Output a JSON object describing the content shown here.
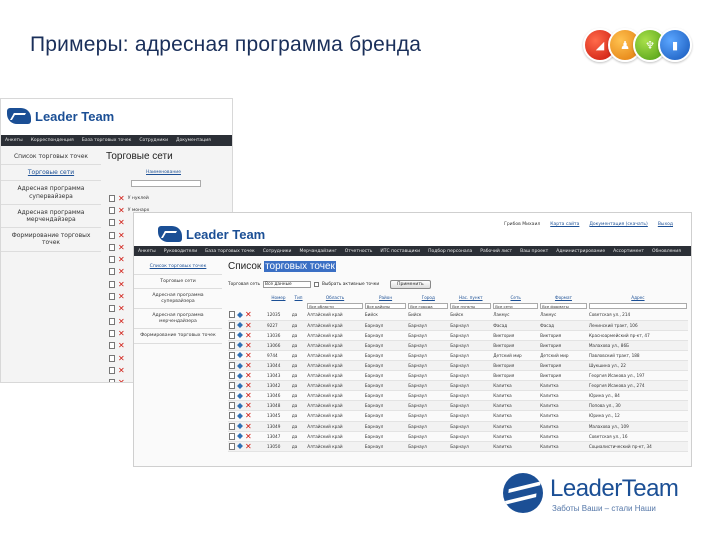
{
  "slide": {
    "title": "Примеры: адресная программа бренда"
  },
  "badges": [
    {
      "icon": "chart-bars-icon",
      "glyph": "◢",
      "color": "#d3160c"
    },
    {
      "icon": "people-icon",
      "glyph": "♟",
      "color": "#e8870f"
    },
    {
      "icon": "trophy-icon",
      "glyph": "♆",
      "color": "#5aa51a"
    },
    {
      "icon": "book-icon",
      "glyph": "▮",
      "color": "#1c5fc0"
    }
  ],
  "back_screen": {
    "logo": "Leader Team",
    "menu": [
      "Анкеты",
      "Корреспонденция",
      "База торговых точек",
      "Сотрудники",
      "Документация"
    ],
    "sidebar": [
      "Список торговых точек",
      "Торговые сети",
      "Адресная программа супервайзера",
      "Адресная программа мерчендайзера",
      "Формирование торговых точек"
    ],
    "title": "Торговые сети",
    "link": "Наименование",
    "rows": [
      "У нуклей",
      "У монарх"
    ]
  },
  "front_screen": {
    "logo": "Leader Team",
    "top_links": [
      "Грибов Михаил",
      "Карта сайта",
      "Документация (скачать)",
      "Выход"
    ],
    "menu": [
      "Анкеты",
      "Руководители",
      "База торговых точек",
      "Сотрудники",
      "Мерчандайзинг",
      "Отчетность",
      "ИТС поставщики",
      "Подбор персонала",
      "Рабочий лист",
      "Ваш проект",
      "Администрирование",
      "Ассортимент",
      "Обновления"
    ],
    "sidebar": [
      "Список торговых точек",
      "Торговые сети",
      "Адресная программа супервайзера",
      "Адресная программа мерчендайзера",
      "Формирование торговых точек"
    ],
    "title_plain": "Список ",
    "title_highlight": "торговых точек",
    "toolbar": {
      "filter_label": "Торговая сеть",
      "filter_value": "Все данные",
      "checkbox_label": "Выбрать активные точки",
      "button": "Применить"
    },
    "columns": [
      "",
      "Номер",
      "Тип",
      "Область",
      "Район",
      "Город",
      "Нас. пункт",
      "Сеть",
      "Формат",
      "Адрес"
    ],
    "filters": [
      "",
      "",
      "",
      "Все области",
      "Все районы",
      "Все города",
      "Все пункты",
      "Все сети",
      "Все форматы",
      ""
    ],
    "rows": [
      [
        "12035",
        "да",
        "Алтайский край",
        "Бийск",
        "Бийск",
        "Лакмус",
        "Лакмус",
        "Советская ул., 214"
      ],
      [
        "9227",
        "да",
        "Алтайский край",
        "Барнаул",
        "Барнаул",
        "Фасад",
        "Фасад",
        "Ленинский тракт, 106"
      ],
      [
        "13036",
        "да",
        "Алтайский край",
        "Барнаул",
        "Барнаул",
        "Виктория",
        "Виктория",
        "Красноармейский пр-кт, 47"
      ],
      [
        "13066",
        "да",
        "Алтайский край",
        "Барнаул",
        "Барнаул",
        "Виктория",
        "Виктория",
        "Малахова ул., 86Б"
      ],
      [
        "9744",
        "да",
        "Алтайский край",
        "Барнаул",
        "Барнаул",
        "Детский мир",
        "Детский мир",
        "Павловский тракт, 188"
      ],
      [
        "13044",
        "да",
        "Алтайский край",
        "Барнаул",
        "Барнаул",
        "Виктория",
        "Виктория",
        "Шукшина ул., 22"
      ],
      [
        "13043",
        "да",
        "Алтайский край",
        "Барнаул",
        "Барнаул",
        "Виктория",
        "Виктория",
        "Георгия Исакова ул., 197"
      ],
      [
        "13042",
        "да",
        "Алтайский край",
        "Барнаул",
        "Барнаул",
        "Калитка",
        "Калитка",
        "Георгия Исакова ул., 274"
      ],
      [
        "13046",
        "да",
        "Алтайский край",
        "Барнаул",
        "Барнаул",
        "Калитка",
        "Калитка",
        "Юрина ул., 84"
      ],
      [
        "13048",
        "да",
        "Алтайский край",
        "Барнаул",
        "Барнаул",
        "Калитка",
        "Калитка",
        "Попова ул., 30"
      ],
      [
        "13045",
        "да",
        "Алтайский край",
        "Барнаул",
        "Барнаул",
        "Калитка",
        "Калитка",
        "Юрина ул., 12"
      ],
      [
        "13049",
        "да",
        "Алтайский край",
        "Барнаул",
        "Барнаул",
        "Калитка",
        "Калитка",
        "Малахова ул., 109"
      ],
      [
        "13047",
        "да",
        "Алтайский край",
        "Барнаул",
        "Барнаул",
        "Калитка",
        "Калитка",
        "Советская ул., 16"
      ],
      [
        "13050",
        "да",
        "Алтайский край",
        "Барнаул",
        "Барнаул",
        "Калитка",
        "Калитка",
        "Социалистический пр-кт, 34"
      ]
    ]
  },
  "brand": {
    "name": "LeaderTeam",
    "slogan": "Заботы Ваши – стали Наши"
  }
}
